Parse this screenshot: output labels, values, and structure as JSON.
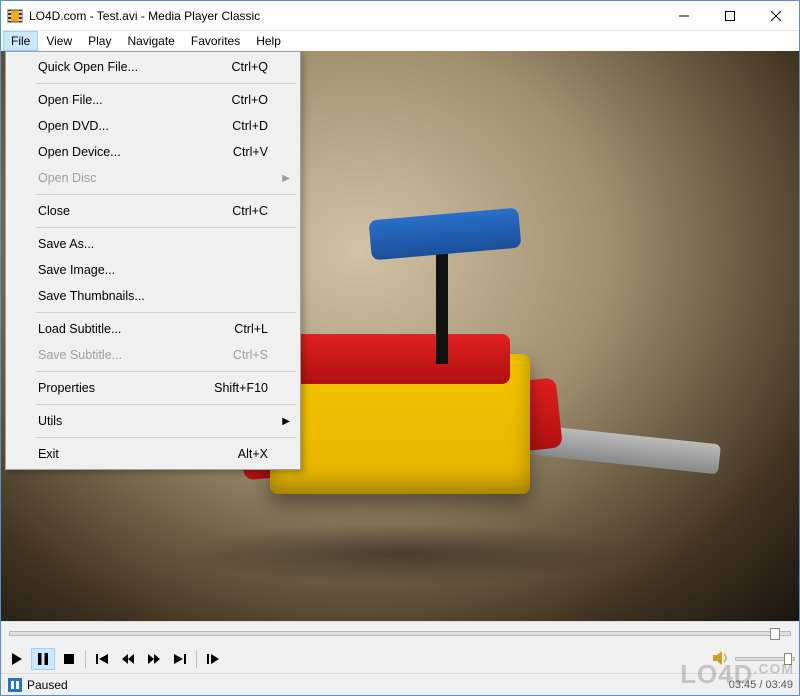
{
  "title": "LO4D.com - Test.avi - Media Player Classic",
  "watermark": "LO4D",
  "watermark_suffix": ".COM",
  "menus": {
    "file": "File",
    "view": "View",
    "play": "Play",
    "navigate": "Navigate",
    "favorites": "Favorites",
    "help": "Help"
  },
  "file_menu": {
    "quick_open": {
      "label": "Quick Open File...",
      "shortcut": "Ctrl+Q"
    },
    "open_file": {
      "label": "Open File...",
      "shortcut": "Ctrl+O"
    },
    "open_dvd": {
      "label": "Open DVD...",
      "shortcut": "Ctrl+D"
    },
    "open_device": {
      "label": "Open Device...",
      "shortcut": "Ctrl+V"
    },
    "open_disc": {
      "label": "Open Disc",
      "shortcut": ""
    },
    "close": {
      "label": "Close",
      "shortcut": "Ctrl+C"
    },
    "save_as": {
      "label": "Save As...",
      "shortcut": ""
    },
    "save_image": {
      "label": "Save Image...",
      "shortcut": ""
    },
    "save_thumbs": {
      "label": "Save Thumbnails...",
      "shortcut": ""
    },
    "load_sub": {
      "label": "Load Subtitle...",
      "shortcut": "Ctrl+L"
    },
    "save_sub": {
      "label": "Save Subtitle...",
      "shortcut": "Ctrl+S"
    },
    "properties": {
      "label": "Properties",
      "shortcut": "Shift+F10"
    },
    "utils": {
      "label": "Utils",
      "shortcut": ""
    },
    "exit": {
      "label": "Exit",
      "shortcut": "Alt+X"
    }
  },
  "status": {
    "text": "Paused",
    "time": "03:45 / 03:49"
  }
}
